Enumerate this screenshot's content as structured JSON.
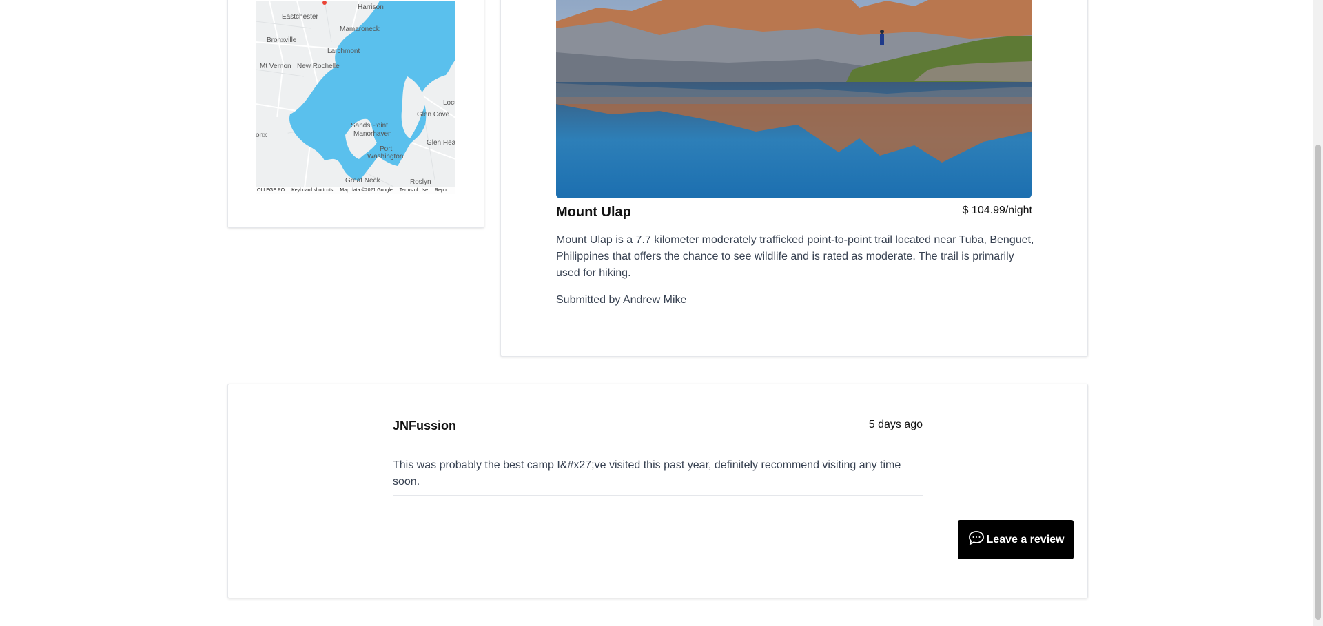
{
  "map": {
    "labels": [
      "Harrison",
      "Eastchester",
      "Mamaroneck",
      "Bronxville",
      "Larchmont",
      "Mt Vernon",
      "New Rochelle",
      "Locu",
      "Glen Cove",
      "Sands Point",
      "Manorhaven",
      "Port",
      "Washington",
      "Glen Head",
      "Great Neck",
      "Roslyn",
      "onx"
    ],
    "footer": {
      "left": "OLLEGE PO",
      "shortcuts": "Keyboard shortcuts",
      "attribution": "Map data ©2021 Google",
      "terms": "Terms of Use",
      "report": "Repor"
    },
    "colors": {
      "water": "#5ac0ed",
      "land": "#eef0f1"
    }
  },
  "campground": {
    "title": "Mount Ulap",
    "price": "$ 104.99/night",
    "description": "Mount Ulap is a 7.7 kilometer moderately trafficked point-to-point trail located near Tuba, Benguet, Philippines that offers the chance to see wildlife and is rated as moderate. The trail is primarily used for hiking.",
    "submitted_by": "Submitted by Andrew Mike"
  },
  "review": {
    "author": "JNFussion",
    "time": "5 days ago",
    "text": "This was probably the best camp I&#x27;ve visited this past year, definitely recommend visiting any time soon."
  },
  "leave_review": {
    "icon": "chat-bubble-icon",
    "label": "Leave a review"
  }
}
